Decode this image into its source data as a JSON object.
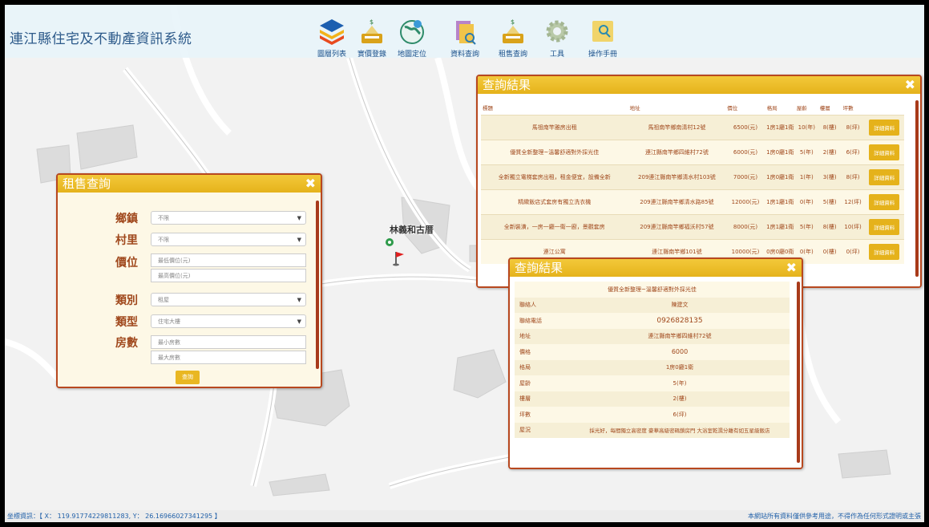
{
  "app": {
    "title": "連江縣住宅及不動產資訊系統"
  },
  "toolbar": [
    {
      "label": "圖層列表",
      "icon": "layers-icon"
    },
    {
      "label": "實價登錄",
      "icon": "price-register-icon"
    },
    {
      "label": "地圖定位",
      "icon": "map-locate-icon"
    },
    {
      "label": "資料查詢",
      "icon": "data-query-icon"
    },
    {
      "label": "租售查詢",
      "icon": "rent-sale-query-icon"
    },
    {
      "label": "工具",
      "icon": "gear-icon"
    },
    {
      "label": "操作手冊",
      "icon": "manual-icon"
    }
  ],
  "map": {
    "place_label": "林義和古厝"
  },
  "search_panel": {
    "title": "租售查詢",
    "close": "✖",
    "fields": {
      "township": {
        "label": "鄉鎮",
        "value": "不限"
      },
      "village": {
        "label": "村里",
        "value": "不限"
      },
      "price": {
        "label": "價位",
        "min_placeholder": "最低價位(元)",
        "max_placeholder": "最高價位(元)"
      },
      "category": {
        "label": "類別",
        "value": "租屋"
      },
      "type": {
        "label": "類型",
        "value": "住宅大樓"
      },
      "rooms": {
        "label": "房數",
        "min_placeholder": "最小房數",
        "max_placeholder": "最大房數"
      }
    },
    "search_button": "查詢"
  },
  "results_panel": {
    "title": "查詢結果",
    "close": "✖",
    "columns": [
      "標題",
      "地址",
      "價位",
      "格局",
      "屋齡",
      "樓層",
      "坪數",
      ""
    ],
    "detail_label": "詳細資料",
    "rows": [
      {
        "title": "馬祖南竿雅房出租",
        "address": "馬祖南竿鄉南清村12號",
        "price": "6500(元)",
        "layout": "1房1廳1衛",
        "age": "10(年)",
        "floor": "8(樓)",
        "area": "8(坪)"
      },
      {
        "title": "優質全新整理~溫馨舒適對外採光佳",
        "address": "連江縣南竿鄉四維村72號",
        "price": "6000(元)",
        "layout": "1房0廳1衛",
        "age": "5(年)",
        "floor": "2(樓)",
        "area": "6(坪)"
      },
      {
        "title": "全新獨立電梯套房出租，租金便宜，設備全新",
        "address": "209連江縣南竿鄉清水村103號",
        "price": "7000(元)",
        "layout": "1房0廳1衛",
        "age": "1(年)",
        "floor": "3(樓)",
        "area": "8(坪)"
      },
      {
        "title": "精緻飯店式套房有獨立洗衣機",
        "address": "209連江縣南竿鄉清水路85號",
        "price": "12000(元)",
        "layout": "1房1廳1衛",
        "age": "0(年)",
        "floor": "5(樓)",
        "area": "12(坪)"
      },
      {
        "title": "全新裝潢，一房一廳一衛一廚，景觀套房",
        "address": "209連江縣南竿鄉福沃村57號",
        "price": "8000(元)",
        "layout": "1房1廳1衛",
        "age": "5(年)",
        "floor": "8(樓)",
        "area": "10(坪)"
      },
      {
        "title": "連江公寓",
        "address": "連江縣南竿鄉101號",
        "price": "10000(元)",
        "layout": "0房0廳0衛",
        "age": "0(年)",
        "floor": "0(樓)",
        "area": "0(坪)"
      }
    ]
  },
  "detail_panel": {
    "title": "查詢結果",
    "close": "✖",
    "heading": "優質全新整理~溫馨舒適對外採光佳",
    "fields": [
      {
        "label": "聯絡人",
        "value": "陳建文"
      },
      {
        "label": "聯絡電話",
        "value": "0926828135"
      },
      {
        "label": "地址",
        "value": "連江縣南竿鄉四維村72號"
      },
      {
        "label": "價格",
        "value": "6000"
      },
      {
        "label": "格局",
        "value": "1房0廳1衛"
      },
      {
        "label": "屋齡",
        "value": "5(年)"
      },
      {
        "label": "樓層",
        "value": "2(樓)"
      },
      {
        "label": "坪數",
        "value": "6(坪)"
      },
      {
        "label": "屋況",
        "value": "採光好，每間獨立高密度 豪華高級密碼鎖房門 大浴室乾濕分離有如五星級飯店"
      }
    ]
  },
  "statusbar": {
    "coord": "坐標資訊：【 X： 119.91774229811283, Y： 26.16966027341295 】",
    "disclaimer": "本網站所有資料僅供參考用途，不得作為任何形式證明或主張"
  },
  "colors": {
    "accent": "#e5b21b",
    "border": "#b8481f",
    "text": "#a0481c",
    "title_blue": "#2d5a8a"
  }
}
